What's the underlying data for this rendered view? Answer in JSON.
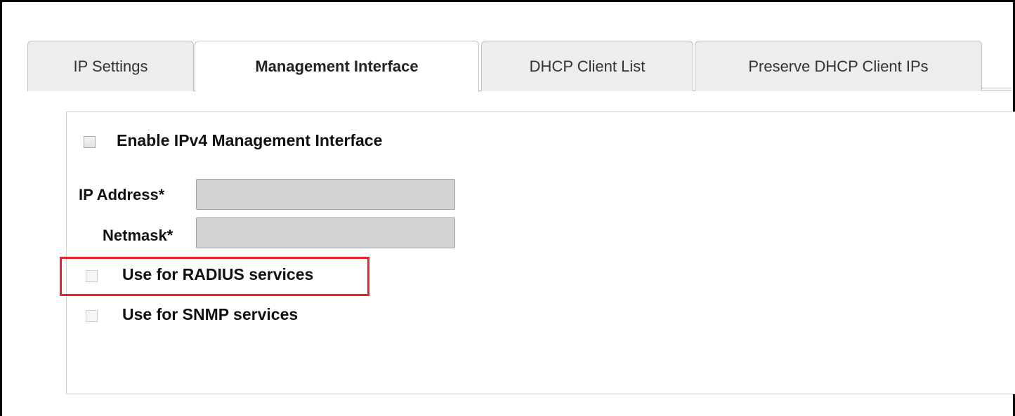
{
  "tabs": [
    {
      "label": "IP Settings",
      "active": false
    },
    {
      "label": "Management Interface",
      "active": true
    },
    {
      "label": "DHCP Client List",
      "active": false
    },
    {
      "label": "Preserve DHCP Client IPs",
      "active": false
    }
  ],
  "form": {
    "enable_ipv4": {
      "label": "Enable IPv4 Management Interface",
      "checked": false
    },
    "ip_address": {
      "label": "IP Address*",
      "value": ""
    },
    "netmask": {
      "label": "Netmask*",
      "value": ""
    },
    "radius": {
      "label": "Use for RADIUS services",
      "checked": false
    },
    "snmp": {
      "label": "Use for SNMP services",
      "checked": false
    }
  },
  "colors": {
    "highlight": "#e8242b",
    "disabled_field": "#d3d3d3"
  }
}
